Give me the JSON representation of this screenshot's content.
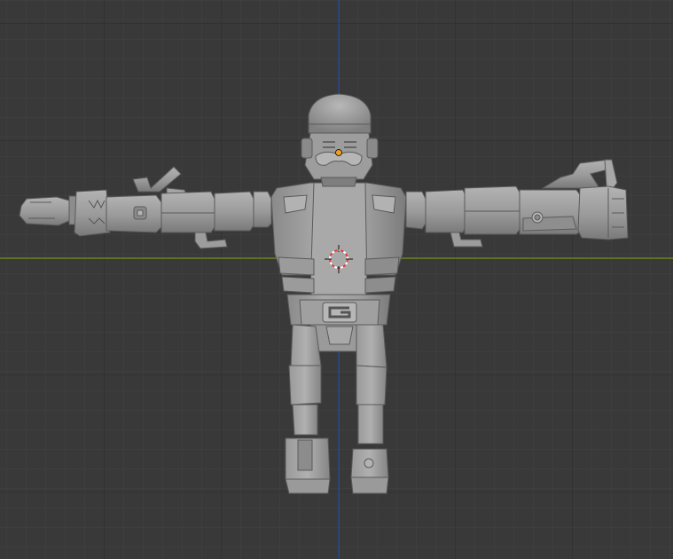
{
  "viewport": {
    "view": "front-orthographic",
    "background_color": "#393939",
    "grid_minor_color": "#444444",
    "grid_major_color": "#2e2e2e",
    "axis_x_color": "#6e9a1a",
    "axis_z_color": "#2d4f9c",
    "model_color": "#9a9a9a"
  },
  "objects": [
    {
      "name": "robot-model",
      "type": "mesh",
      "pose": "t-pose"
    },
    {
      "name": "object-origin",
      "color": "#f0a020"
    },
    {
      "name": "3d-cursor",
      "color": "#e03c3c"
    }
  ]
}
